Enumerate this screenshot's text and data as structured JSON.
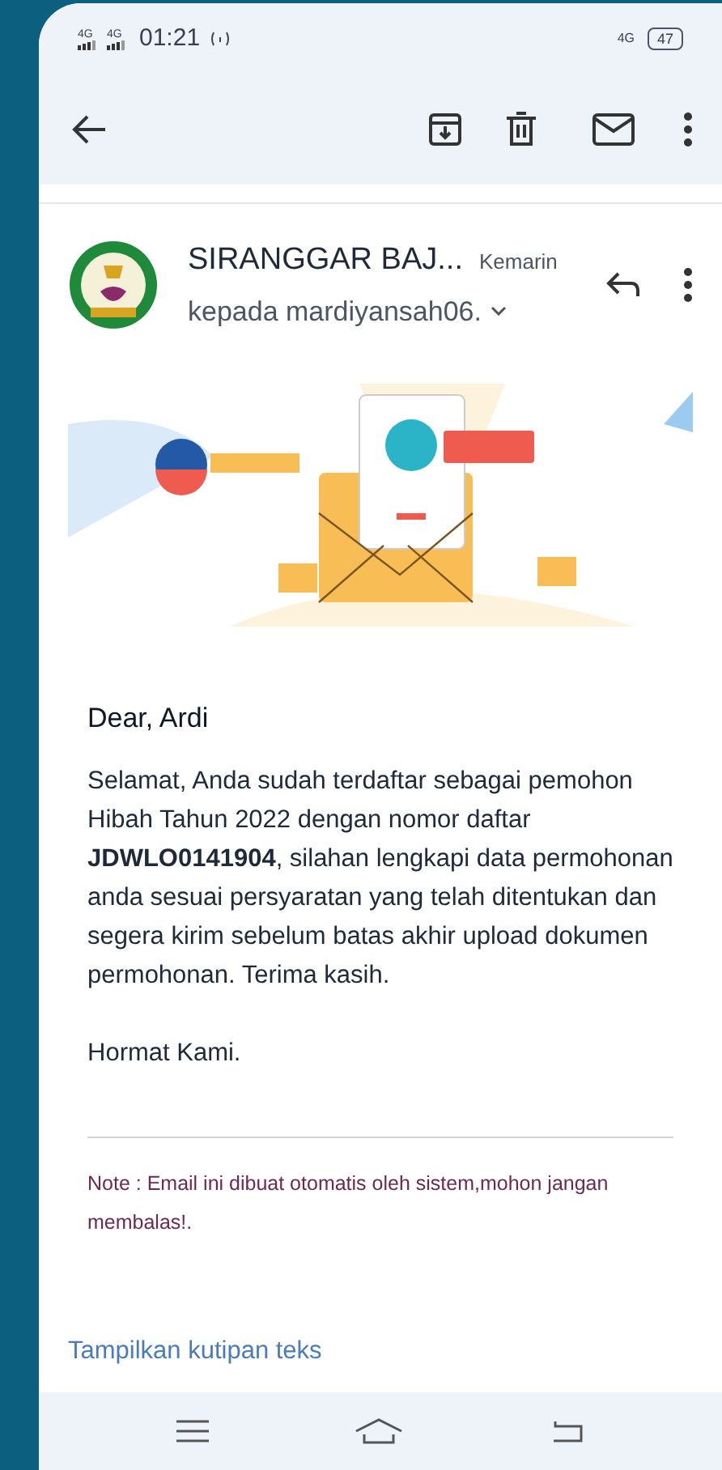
{
  "status_bar": {
    "signal_labels": [
      "4G",
      "4G"
    ],
    "time": "01:21",
    "data_label": "4G",
    "battery": "47"
  },
  "email": {
    "sender": "SIRANGGAR BAJ...",
    "date": "Kemarin",
    "recipient": "kepada mardiyansah06.",
    "greeting": "Dear, Ardi",
    "body": "Selamat, Anda sudah terdaftar sebagai pemohon Hibah Tahun 2022 dengan nomor daftar **JDWLO0141904**, silahan lengkapi data permohonan anda sesuai persyaratan yang telah ditentukan dan segera kirim sebelum batas akhir upload dokumen permohonan. Terima kasih.",
    "closing": "Hormat Kami.",
    "note": "Note : Email ini dibuat otomatis oleh sistem,mohon jangan membalas!.",
    "quoted_link": "Tampilkan kutipan teks"
  }
}
